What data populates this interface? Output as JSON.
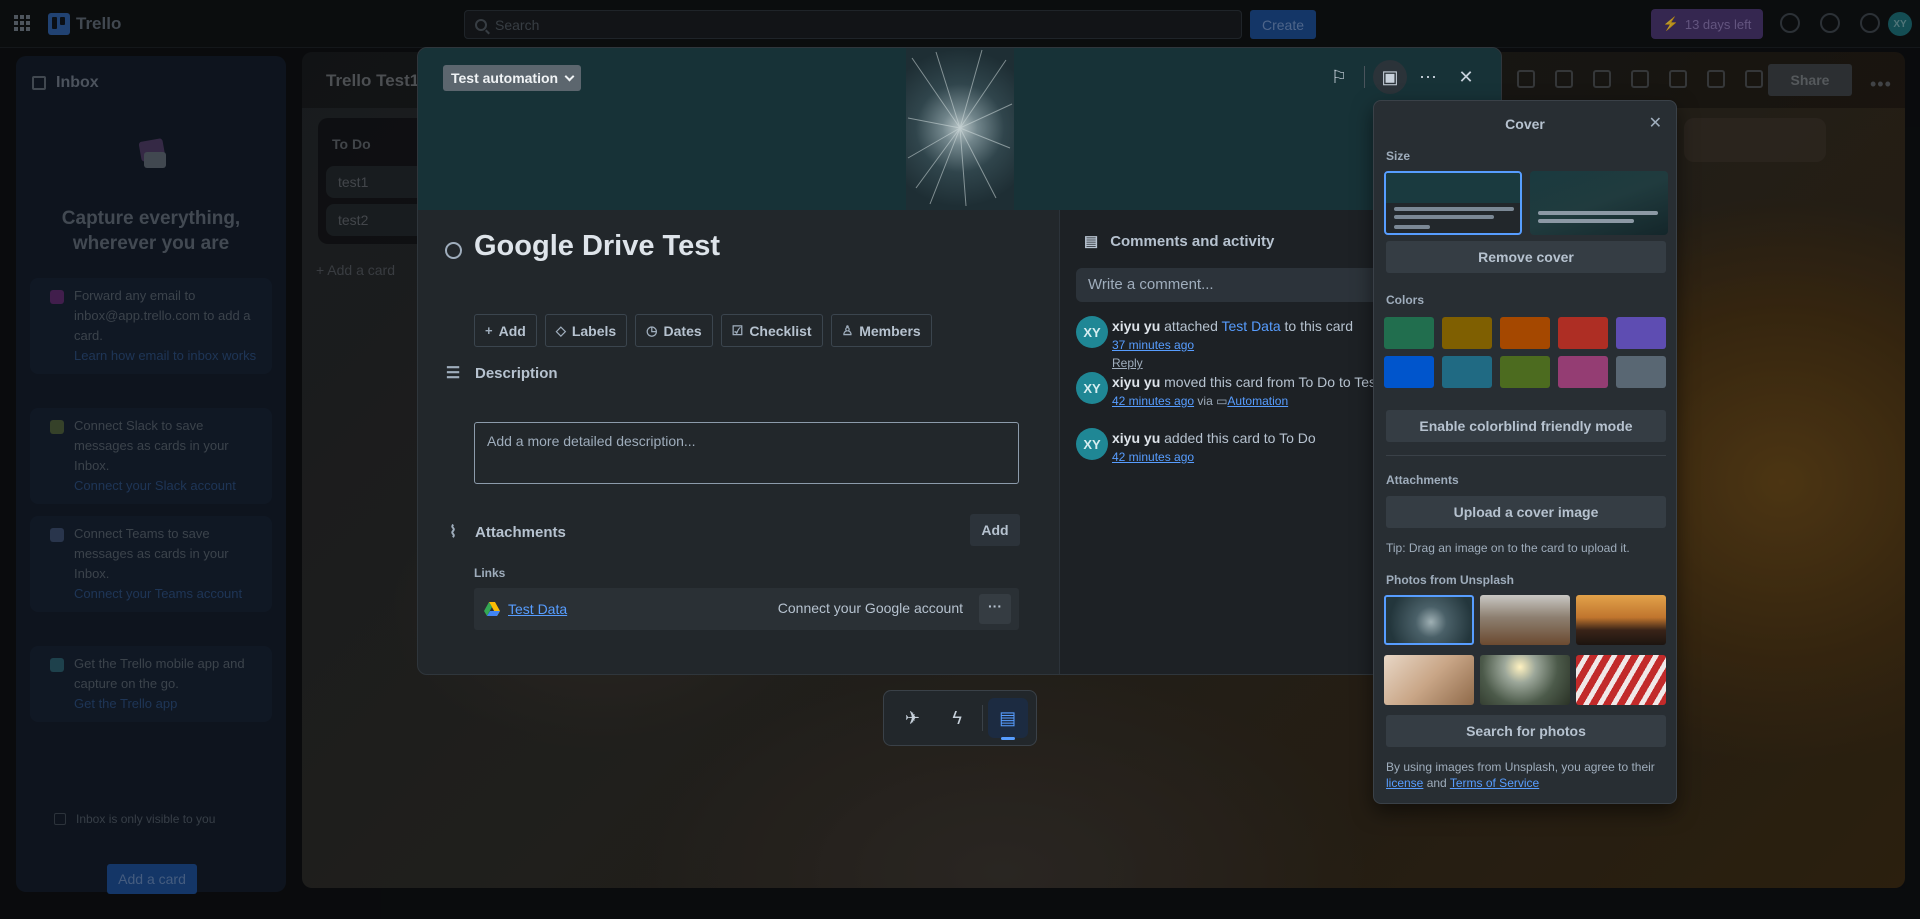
{
  "topbar": {
    "app_name": "Trello",
    "search_placeholder": "Search",
    "create_label": "Create",
    "trial_label": "13 days left",
    "avatar_initials": "XY"
  },
  "inbox": {
    "title": "Inbox",
    "headline": "Capture everything, wherever you are",
    "cards": [
      {
        "text": "Forward any email to inbox@app.trello.com to add a card.",
        "link": "Learn how email to inbox works",
        "icon": "email-icon",
        "color": "#5a2a6a"
      },
      {
        "text": "Connect Slack to save messages as cards in your Inbox.",
        "link": "Connect your Slack account",
        "icon": "slack-icon",
        "color": "#4a5a3a"
      },
      {
        "text": "Connect Teams to save messages as cards in your Inbox.",
        "link": "Connect your Teams account",
        "icon": "teams-icon",
        "color": "#3a4a6a"
      },
      {
        "text": "Get the Trello mobile app and capture on the go.",
        "link": "Get the Trello app",
        "icon": "mobile-icon",
        "color": "#2a5a6a"
      }
    ],
    "visibility_note": "Inbox is only visible to you",
    "add_card_label": "Add a card"
  },
  "board": {
    "title": "Trello Test1",
    "share_label": "Share",
    "list": {
      "title": "To Do",
      "cards": [
        "test1",
        "test2"
      ],
      "add_label": "+ Add a card"
    }
  },
  "card": {
    "list_name": "Test automation",
    "title": "Google Drive Test",
    "actions": [
      {
        "label": "Add",
        "icon": "plus-icon",
        "glyph": "+"
      },
      {
        "label": "Labels",
        "icon": "label-icon",
        "glyph": "◇"
      },
      {
        "label": "Dates",
        "icon": "clock-icon",
        "glyph": "◷"
      },
      {
        "label": "Checklist",
        "icon": "checklist-icon",
        "glyph": "☑"
      },
      {
        "label": "Members",
        "icon": "members-icon",
        "glyph": "♙"
      }
    ],
    "description_heading": "Description",
    "description_placeholder": "Add a more detailed description...",
    "attachments_heading": "Attachments",
    "attachments_add": "Add",
    "links_label": "Links",
    "link_title": "Test Data",
    "link_connect": "Connect your Google account",
    "link_more": "···"
  },
  "activity": {
    "heading": "Comments and activity",
    "comment_placeholder": "Write a comment...",
    "items": [
      {
        "avatar": "XY",
        "user": "xiyu yu",
        "pre": " attached ",
        "link": "Test Data",
        "post": " to this card",
        "time": "37 minutes ago",
        "via": "",
        "via_link": "",
        "reply": "Reply"
      },
      {
        "avatar": "XY",
        "user": "xiyu yu",
        "pre": " moved this card from To Do to Test",
        "link": "",
        "post": "",
        "time": "42 minutes ago",
        "via": " via ",
        "via_link": "Automation",
        "reply": ""
      },
      {
        "avatar": "XY",
        "user": "xiyu yu",
        "pre": " added this card to To Do",
        "link": "",
        "post": "",
        "time": "42 minutes ago",
        "via": "",
        "via_link": "",
        "reply": ""
      }
    ]
  },
  "cover_panel": {
    "title": "Cover",
    "size_label": "Size",
    "remove_cover": "Remove cover",
    "colors_label": "Colors",
    "colors": [
      "#216e4e",
      "#7f5f01",
      "#a54800",
      "#ae2e24",
      "#5e4db2",
      "#0055cc",
      "#206a83",
      "#4c6b1f",
      "#943d73",
      "#596773"
    ],
    "colorblind_label": "Enable colorblind friendly mode",
    "attachments_label": "Attachments",
    "upload_label": "Upload a cover image",
    "tip": "Tip: Drag an image on to the card to upload it.",
    "unsplash_label": "Photos from Unsplash",
    "search_photos": "Search for photos",
    "legal_pre": "By using images from Unsplash, you agree to their ",
    "legal_license": "license",
    "legal_and": " and ",
    "legal_terms": "Terms of Service"
  }
}
